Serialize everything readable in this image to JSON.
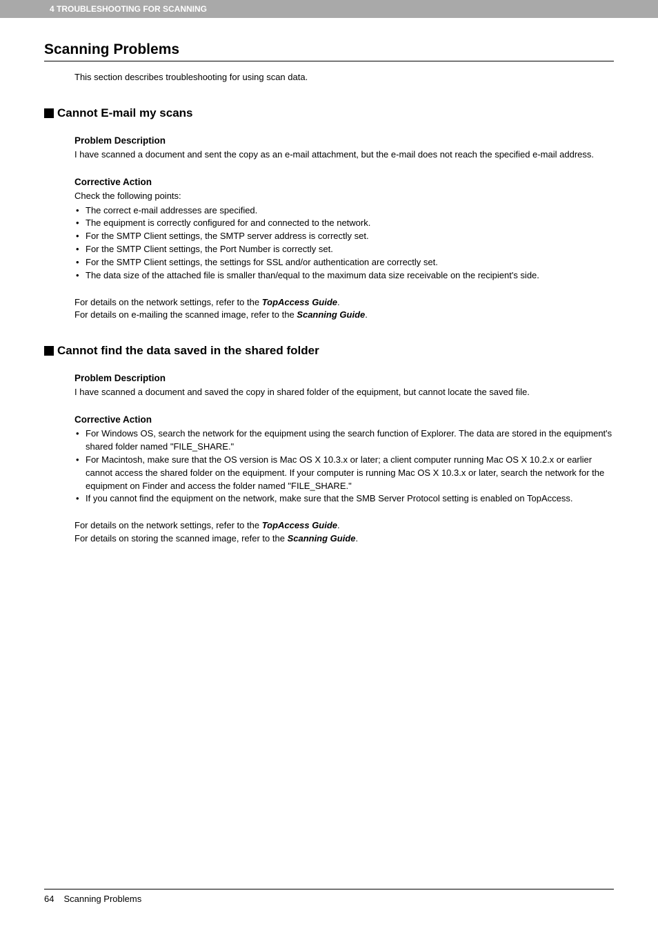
{
  "header": "4 TROUBLESHOOTING FOR SCANNING",
  "title": "Scanning Problems",
  "intro": "This section describes troubleshooting for using scan data.",
  "s1": {
    "heading": "Cannot E-mail my scans",
    "pd_h": "Problem Description",
    "pd_t": "I have scanned a document and sent the copy as an e-mail attachment, but the e-mail does not reach the specified e-mail address.",
    "ca_h": "Corrective Action",
    "lead": "Check the following points:",
    "items": [
      "The correct e-mail addresses are specified.",
      "The equipment is correctly configured for and connected to the network.",
      "For the SMTP Client settings, the SMTP server address is correctly set.",
      "For the SMTP Client settings, the Port Number is correctly set.",
      "For the SMTP Client settings, the settings for SSL and/or authentication are correctly set.",
      "The data size of the attached file is smaller than/equal to the maximum data size receivable on the recipient's side."
    ],
    "ref1_a": "For details on the network settings, refer to the ",
    "ref1_b": "TopAccess Guide",
    "ref2_a": "For details on e-mailing the scanned image, refer to the ",
    "ref2_b": "Scanning Guide"
  },
  "s2": {
    "heading": "Cannot find the data saved in the shared folder",
    "pd_h": "Problem Description",
    "pd_t": "I have scanned a document and saved the copy in shared folder of the equipment, but cannot locate the saved file.",
    "ca_h": "Corrective Action",
    "items": [
      "For Windows OS, search the network for the equipment using the search function of Explorer. The data are stored in the equipment's shared folder named \"FILE_SHARE.\"",
      "For Macintosh, make sure that the OS version is Mac OS X 10.3.x or later; a client computer running Mac OS X 10.2.x or earlier cannot access the shared folder on the equipment. If your computer is running Mac OS X 10.3.x or later, search the network for the equipment on Finder and access the folder named \"FILE_SHARE.\"",
      "If you cannot find the equipment on the network, make sure that the SMB Server Protocol setting is enabled on TopAccess."
    ],
    "ref1_a": "For details on the network settings, refer to the ",
    "ref1_b": "TopAccess Guide",
    "ref2_a": "For details on storing the scanned image, refer to the ",
    "ref2_b": "Scanning Guide"
  },
  "footer": {
    "page": "64",
    "title": "Scanning Problems"
  }
}
